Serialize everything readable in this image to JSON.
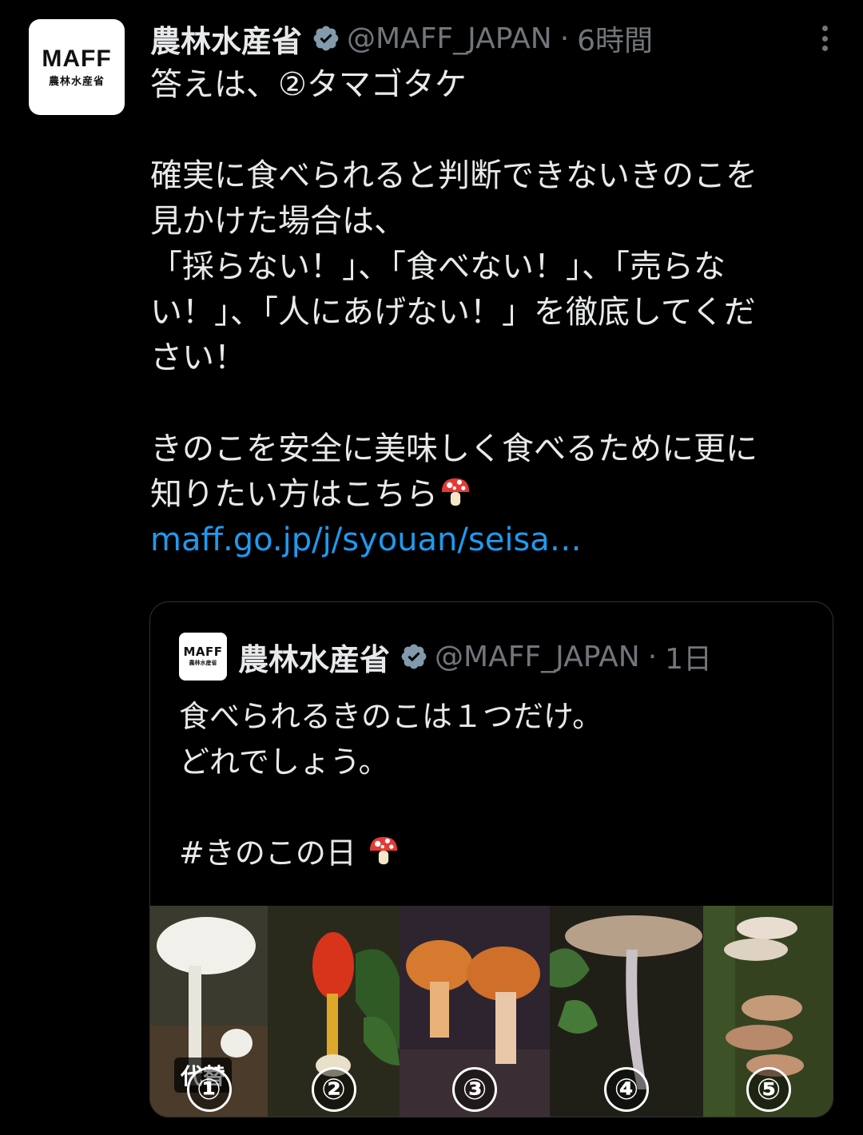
{
  "tweet": {
    "avatar": {
      "logo_top": "MAFF",
      "logo_bottom": "農林水産省"
    },
    "display_name": "農林水産省",
    "handle": "@MAFF_JAPAN",
    "separator": "·",
    "time": "6時間",
    "lines": [
      "答えは、②タマゴタケ",
      "",
      "確実に食べられると判断できないきのこを",
      "見かけた場合は、",
      "「採らない！」、「食べない！」、「売らな",
      "い！」、「人にあげない！」を徹底してくだ",
      "さい！",
      "",
      "きのこを安全に美味しく食べるために更に"
    ],
    "last_line": "知りたい方はこちら",
    "last_line_emoji": "mushroom-emoji",
    "link": "maff.go.jp/j/syouan/seisa…"
  },
  "quoted": {
    "avatar": {
      "logo_top": "MAFF",
      "logo_bottom": "農林水産省"
    },
    "display_name": "農林水産省",
    "handle": "@MAFF_JAPAN",
    "separator": "·",
    "time": "1日",
    "lines": [
      "食べられるきのこは１つだけ。",
      "どれでしょう。",
      ""
    ],
    "hashtag_line": "#きのこの日",
    "hashtag_emoji": "mushroom-emoji",
    "alt_badge": "代替",
    "panels": [
      {
        "number": "①",
        "desc": "white-mushroom"
      },
      {
        "number": "②",
        "desc": "red-egg-mushroom"
      },
      {
        "number": "③",
        "desc": "orange-bolete"
      },
      {
        "number": "④",
        "desc": "tan-flat-cap"
      },
      {
        "number": "⑤",
        "desc": "bracket-fungus"
      }
    ]
  },
  "colors": {
    "background": "#000000",
    "text": "#e7e9ea",
    "muted": "#71767b",
    "link": "#1d9bf0",
    "verified": "#829aab",
    "border": "#2f3336"
  }
}
